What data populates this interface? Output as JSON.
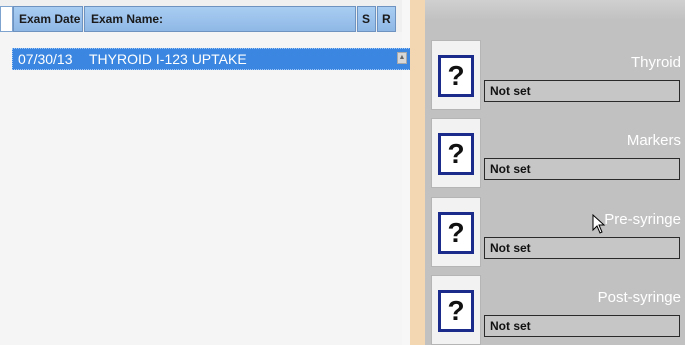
{
  "table": {
    "headers": {
      "exam_date": "Exam Date",
      "exam_name": "Exam Name:",
      "s": "S",
      "r": "R"
    },
    "rows": [
      {
        "exam_date": "07/30/13",
        "exam_name": "THYROID I-123 UPTAKE"
      }
    ]
  },
  "status_items": [
    {
      "label": "Thyroid",
      "value": "Not set",
      "icon": "question-mark-icon"
    },
    {
      "label": "Markers",
      "value": "Not set",
      "icon": "question-mark-icon"
    },
    {
      "label": "Pre-syringe",
      "value": "Not set",
      "icon": "question-mark-icon"
    },
    {
      "label": "Post-syringe",
      "value": "Not set",
      "icon": "question-mark-icon"
    }
  ],
  "icon_glyph": "?",
  "colors": {
    "selected_row": "#3a86e0",
    "header": "#a9cdf2",
    "right_panel": "#c1c1c1",
    "divider": "#f3d7b2",
    "icon_border": "#1b2b8c"
  }
}
